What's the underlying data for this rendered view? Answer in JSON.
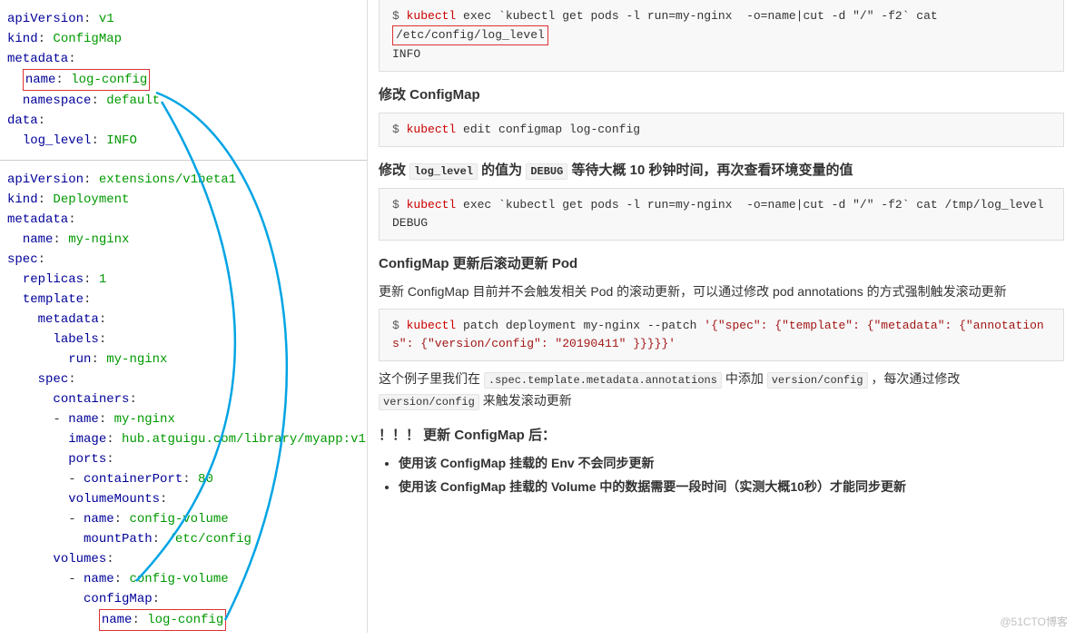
{
  "yaml_configmap": {
    "apiVersion_k": "apiVersion",
    "apiVersion_v": "v1",
    "kind_k": "kind",
    "kind_v": "ConfigMap",
    "metadata_k": "metadata",
    "name_k": "name",
    "name_v": "log-config",
    "namespace_k": "namespace",
    "namespace_v": "default",
    "data_k": "data",
    "log_level_k": "log_level",
    "log_level_v": "INFO"
  },
  "yaml_deploy": {
    "apiVersion_k": "apiVersion",
    "apiVersion_v": "extensions/v1beta1",
    "kind_k": "kind",
    "kind_v": "Deployment",
    "metadata_k": "metadata",
    "name_k": "name",
    "name_v": "my-nginx",
    "spec_k": "spec",
    "replicas_k": "replicas",
    "replicas_v": "1",
    "template_k": "template",
    "labels_k": "labels",
    "run_k": "run",
    "run_v": "my-nginx",
    "containers_k": "containers",
    "cname_v": "my-nginx",
    "image_k": "image",
    "image_v": "hub.atguigu.com/library/myapp:v1",
    "ports_k": "ports",
    "cport_k": "containerPort",
    "cport_v": "80",
    "volmounts_k": "volumeMounts",
    "vmname_v": "config-volume",
    "mountpath_k": "mountPath",
    "mountpath_v": "/etc/config",
    "volumes_k": "volumes",
    "volname_v": "config-volume",
    "configmap_k": "configMap",
    "cmname_v": "log-config"
  },
  "right": {
    "code1_prompt": "$ ",
    "code1_cmd": "kubectl",
    "code1_rest": " exec `kubectl get pods -l run=my-nginx  -o=name|cut -d \"/\" -f2` cat ",
    "code1_path": "/etc/config/log_level",
    "code1_out": "INFO",
    "h1": "修改 ConfigMap",
    "code2_prompt": "$ ",
    "code2_cmd": "kubectl",
    "code2_rest": " edit configmap log-config",
    "h2_pre": "修改 ",
    "h2_code1": "log_level",
    "h2_mid": " 的值为 ",
    "h2_code2": "DEBUG",
    "h2_post": " 等待大概 10 秒钟时间，再次查看环境变量的值",
    "code3_prompt": "$ ",
    "code3_cmd": "kubectl",
    "code3_rest": " exec `kubectl get pods -l run=my-nginx  -o=name|cut -d \"/\" -f2` cat /tmp/log_level",
    "code3_out": "DEBUG",
    "h3": "ConfigMap 更新后滚动更新 Pod",
    "p1": "更新 ConfigMap 目前并不会触发相关 Pod 的滚动更新，可以通过修改 pod annotations 的方式强制触发滚动更新",
    "code4_prompt": "$ ",
    "code4_cmd": "kubectl",
    "code4_mid": " patch deployment my-nginx --patch ",
    "code4_json": "'{\"spec\": {\"template\": {\"metadata\": {\"annotations\": {\"version/config\": \"20190411\" }}}}}'",
    "p2_a": "这个例子里我们在 ",
    "p2_code1": ".spec.template.metadata.annotations",
    "p2_b": " 中添加 ",
    "p2_code2": "version/config",
    "p2_c": " ，每次通过修改 ",
    "p2_code3": "version/config",
    "p2_d": " 来触发滚动更新",
    "h4": "！！！ 更新 ConfigMap 后：",
    "li1": "使用该 ConfigMap 挂载的 Env 不会同步更新",
    "li2": "使用该 ConfigMap 挂载的 Volume 中的数据需要一段时间（实测大概10秒）才能同步更新",
    "watermark": "@51CTO博客"
  }
}
